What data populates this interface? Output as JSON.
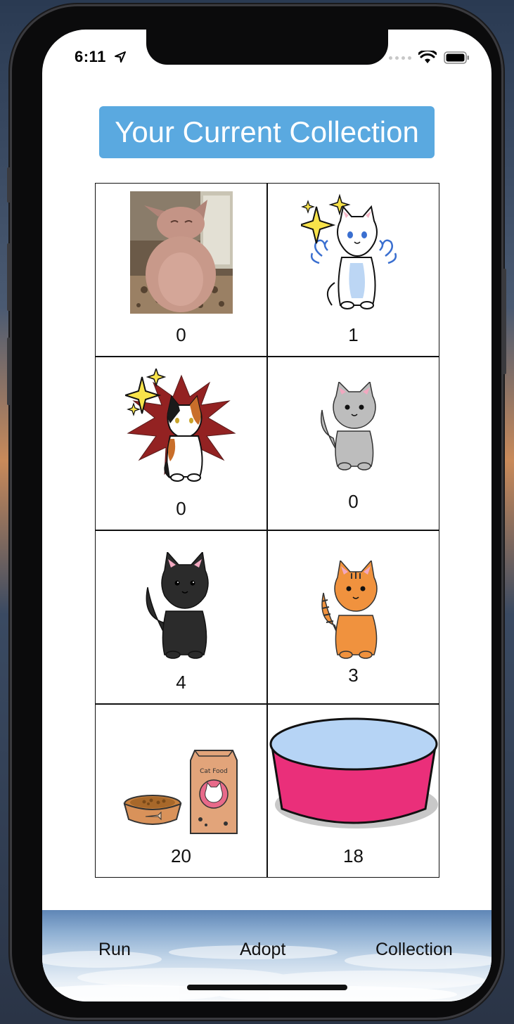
{
  "status_bar": {
    "time": "6:11",
    "icons": [
      "location-arrow-icon",
      "signal-dots-icon",
      "wifi-icon",
      "battery-icon"
    ]
  },
  "header": {
    "title": "Your Current Collection",
    "color": "#5aa9e0"
  },
  "collection": {
    "items": [
      {
        "name": "hairless cat photo",
        "count": "0"
      },
      {
        "name": "sparkly white cat",
        "count": "1"
      },
      {
        "name": "sparkly calico cat",
        "count": "0"
      },
      {
        "name": "gray cat",
        "count": "0"
      },
      {
        "name": "black cat",
        "count": "4"
      },
      {
        "name": "orange tabby cat",
        "count": "3"
      },
      {
        "name": "cat food",
        "count": "20"
      },
      {
        "name": "water bowl",
        "count": "18"
      }
    ]
  },
  "tabbar": {
    "tabs": [
      {
        "label": "Run"
      },
      {
        "label": "Adopt"
      },
      {
        "label": "Collection"
      }
    ]
  }
}
